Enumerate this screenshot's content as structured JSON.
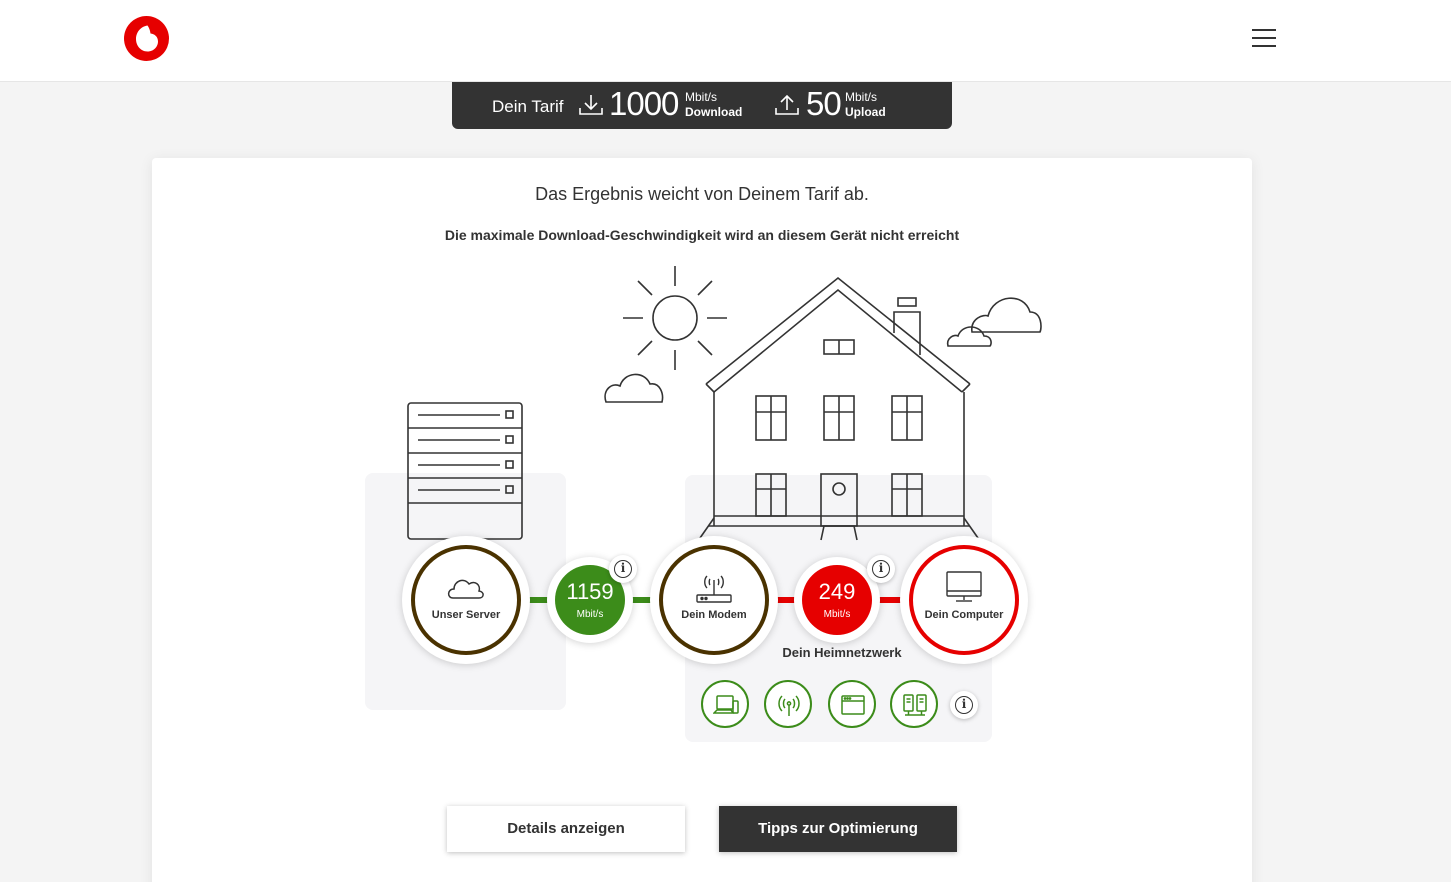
{
  "tariff": {
    "label": "Dein Tarif",
    "download_value": "1000",
    "download_unit": "Mbit/s",
    "download_label": "Download",
    "upload_value": "50",
    "upload_unit": "Mbit/s",
    "upload_label": "Upload"
  },
  "result": {
    "title": "Das Ergebnis weicht von Deinem Tarif ab.",
    "subtitle": "Die maximale Download-Geschwindigkeit wird an diesem Gerät nicht erreicht"
  },
  "nodes": {
    "server": "Unser Server",
    "modem": "Dein Modem",
    "computer": "Dein Computer"
  },
  "speeds": {
    "server_modem": {
      "value": "1159",
      "unit": "Mbit/s",
      "color": "#3c8c1a"
    },
    "modem_computer": {
      "value": "249",
      "unit": "Mbit/s",
      "color": "#e60000"
    }
  },
  "home_network_label": "Dein Heimnetzwerk",
  "info_glyph": "i",
  "devices": [
    "laptop-icon",
    "wifi-icon",
    "browser-icon",
    "powerline-icon"
  ],
  "buttons": {
    "details": "Details anzeigen",
    "tips": "Tipps zur Optimierung"
  },
  "colors": {
    "brand": "#e60000",
    "good": "#3c8c1a",
    "ring": "#4a3200",
    "dark": "#333333"
  }
}
